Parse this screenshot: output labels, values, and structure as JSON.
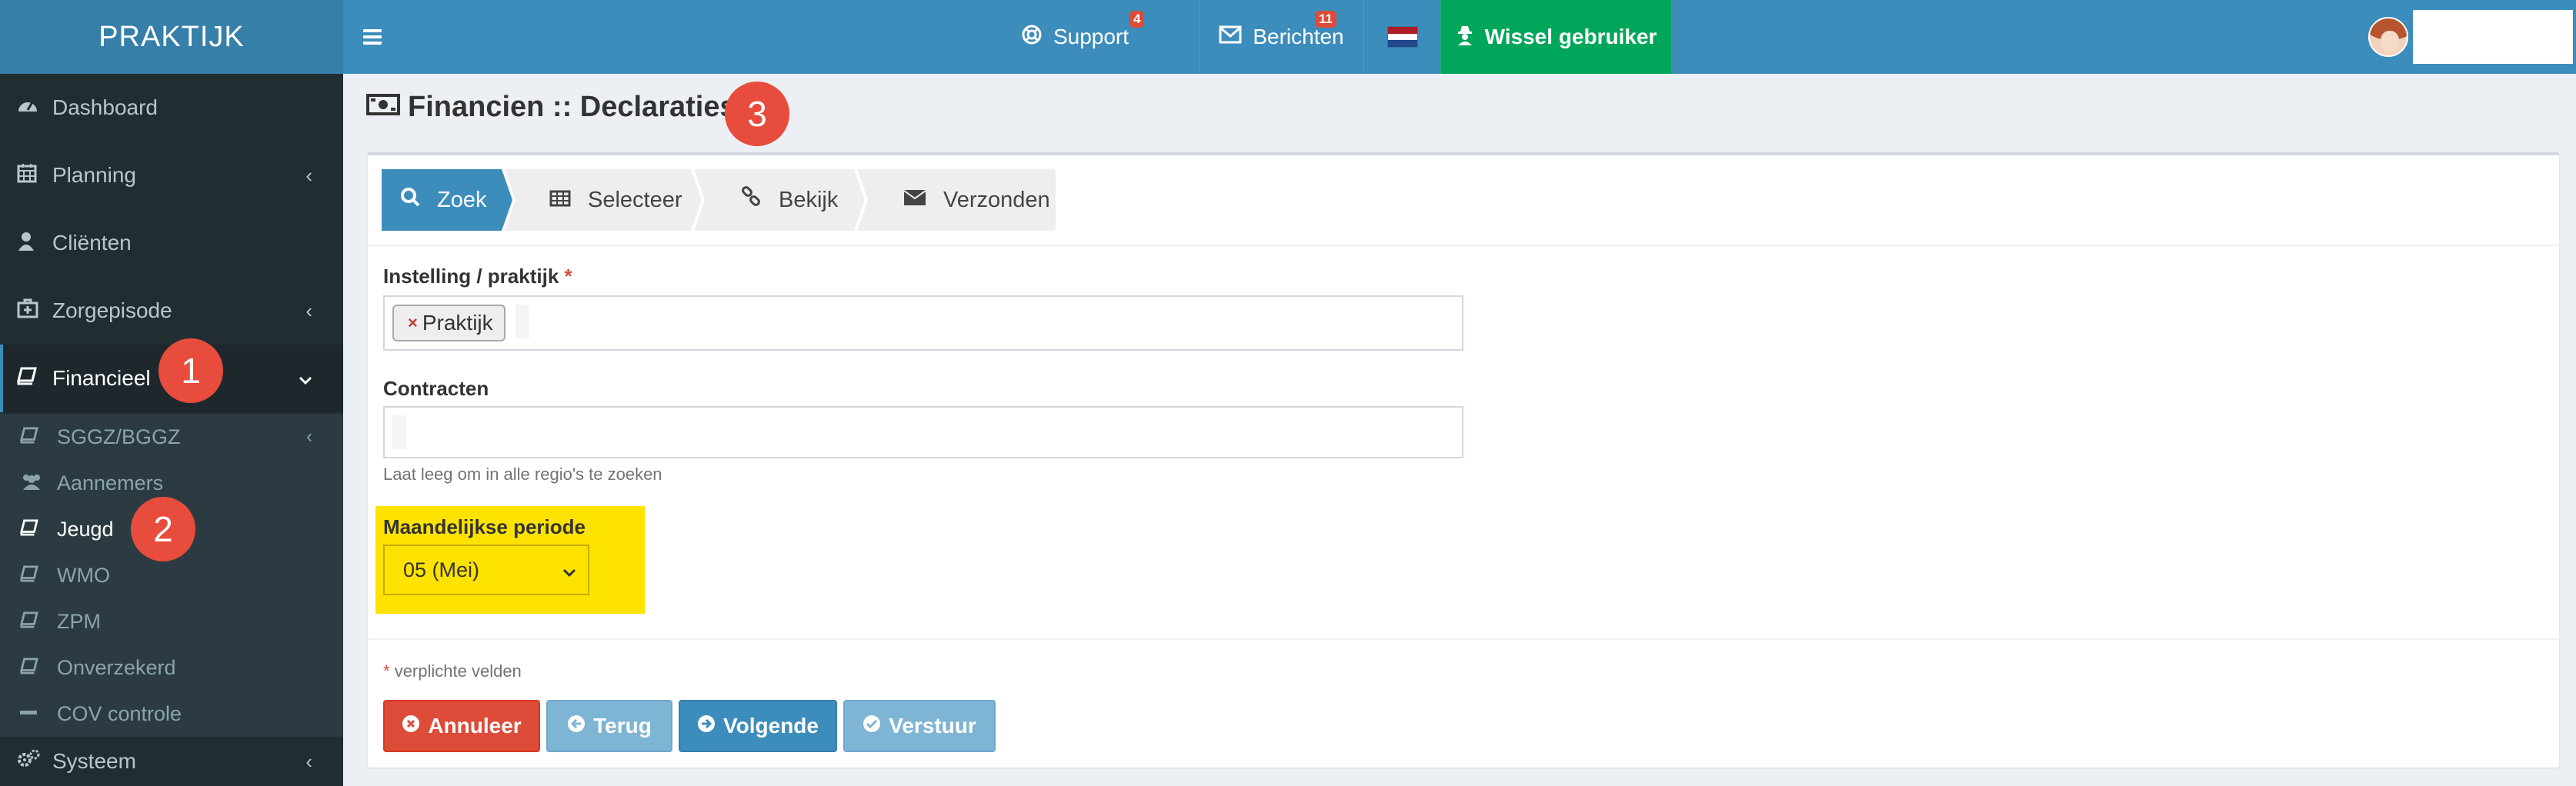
{
  "app": {
    "logo": "PRAKTIJK"
  },
  "topbar": {
    "menu_icon": "hamburger-icon",
    "support": {
      "label": "Support",
      "count": "4",
      "icon": "life-ring-icon"
    },
    "messages": {
      "label": "Berichten",
      "count": "11",
      "icon": "envelope-icon"
    },
    "language": {
      "icon": "flag-nl-icon"
    },
    "switch_user": {
      "label": "Wissel gebruiker",
      "icon": "user-secret-icon",
      "color": "#00a65a"
    },
    "user": {
      "icon": "avatar-icon"
    }
  },
  "sidebar": {
    "items": [
      {
        "label": "Dashboard",
        "icon": "dashboard-icon"
      },
      {
        "label": "Planning",
        "icon": "calendar-icon"
      },
      {
        "label": "Cliënten",
        "icon": "user-icon"
      },
      {
        "label": "Zorgepisode",
        "icon": "medkit-icon"
      },
      {
        "label": "Financieel",
        "icon": "book-icon"
      }
    ],
    "submenu": [
      {
        "label": "SGGZ/BGGZ",
        "icon": "book-icon"
      },
      {
        "label": "Aannemers",
        "icon": "users-icon"
      },
      {
        "label": "Jeugd",
        "icon": "book-icon"
      },
      {
        "label": "WMO",
        "icon": "book-icon"
      },
      {
        "label": "ZPM",
        "icon": "book-icon"
      },
      {
        "label": "Onverzekerd",
        "icon": "book-icon"
      },
      {
        "label": "COV controle",
        "icon": "minus-icon"
      }
    ],
    "system": {
      "label": "Systeem",
      "icon": "cogs-icon"
    }
  },
  "annotations": {
    "step1": "1",
    "step2": "2",
    "step3": "3"
  },
  "page": {
    "title": "Financien :: Declaraties",
    "title_icon": "money-icon",
    "wizard": [
      {
        "label": "Zoek",
        "icon": "search-icon"
      },
      {
        "label": "Selecteer",
        "icon": "table-icon"
      },
      {
        "label": "Bekijk",
        "icon": "link-icon"
      },
      {
        "label": "Verzonden",
        "icon": "envelope-icon"
      }
    ],
    "form": {
      "instelling_label": "Instelling / praktijk",
      "required_mark": "*",
      "instelling_tag": "Praktijk",
      "tag_remove": "×",
      "contracten_label": "Contracten",
      "contracten_help": "Laat leeg om in alle regio's te zoeken",
      "periode_label": "Maandelijkse periode",
      "periode_value": "05 (Mei)",
      "highlight_color": "#ffe300"
    },
    "required_note": "verplichte velden",
    "buttons": {
      "cancel": "Annuleer",
      "back": "Terug",
      "next": "Volgende",
      "send": "Verstuur"
    }
  }
}
